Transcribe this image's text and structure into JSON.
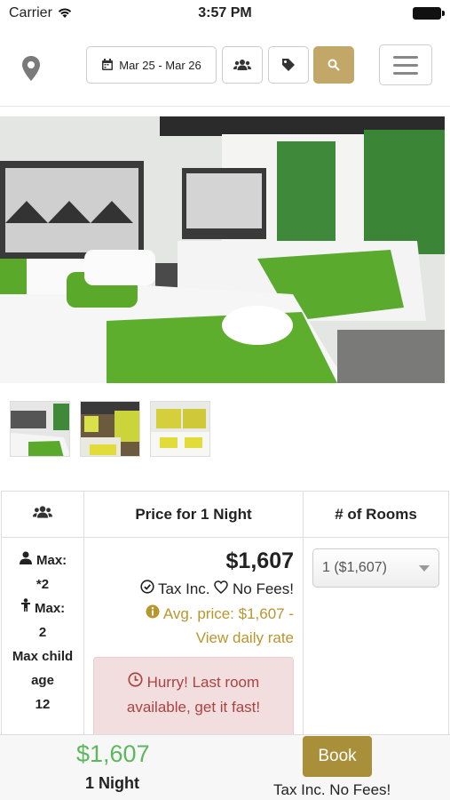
{
  "status_bar": {
    "carrier": "Carrier",
    "time": "3:57 PM"
  },
  "nav": {
    "date_range": "Mar 25 - Mar 26",
    "icons": [
      "map-pin-icon",
      "calendar-icon",
      "users-icon",
      "tag-icon",
      "search-icon",
      "hamburger-menu-icon"
    ],
    "accent_color": "#c2a868"
  },
  "table": {
    "headers": {
      "guests_icon": "users-icon",
      "price": "Price for 1 Night",
      "rooms": "# of Rooms"
    },
    "occupancy": {
      "max_adults_label": "Max:",
      "max_adults": "*2",
      "max_children_label": "Max:",
      "max_children": "2",
      "max_child_age_label": "Max child age",
      "max_child_age": "12"
    },
    "price": "$1,607",
    "tax_inc": "Tax Inc.",
    "no_fees": "No Fees!",
    "avg_price": "Avg. price: $1,607 -",
    "daily_rate_link": "View daily rate",
    "alert": "Hurry! Last room available, get it fast!",
    "rooms_select": "1 ($1,607)"
  },
  "footer": {
    "price": "$1,607",
    "nights": "1 Night",
    "book_label": "Book",
    "fees_note": "Tax Inc. No Fees!",
    "price_color": "#5cb85c",
    "book_color": "#a98f3a"
  }
}
